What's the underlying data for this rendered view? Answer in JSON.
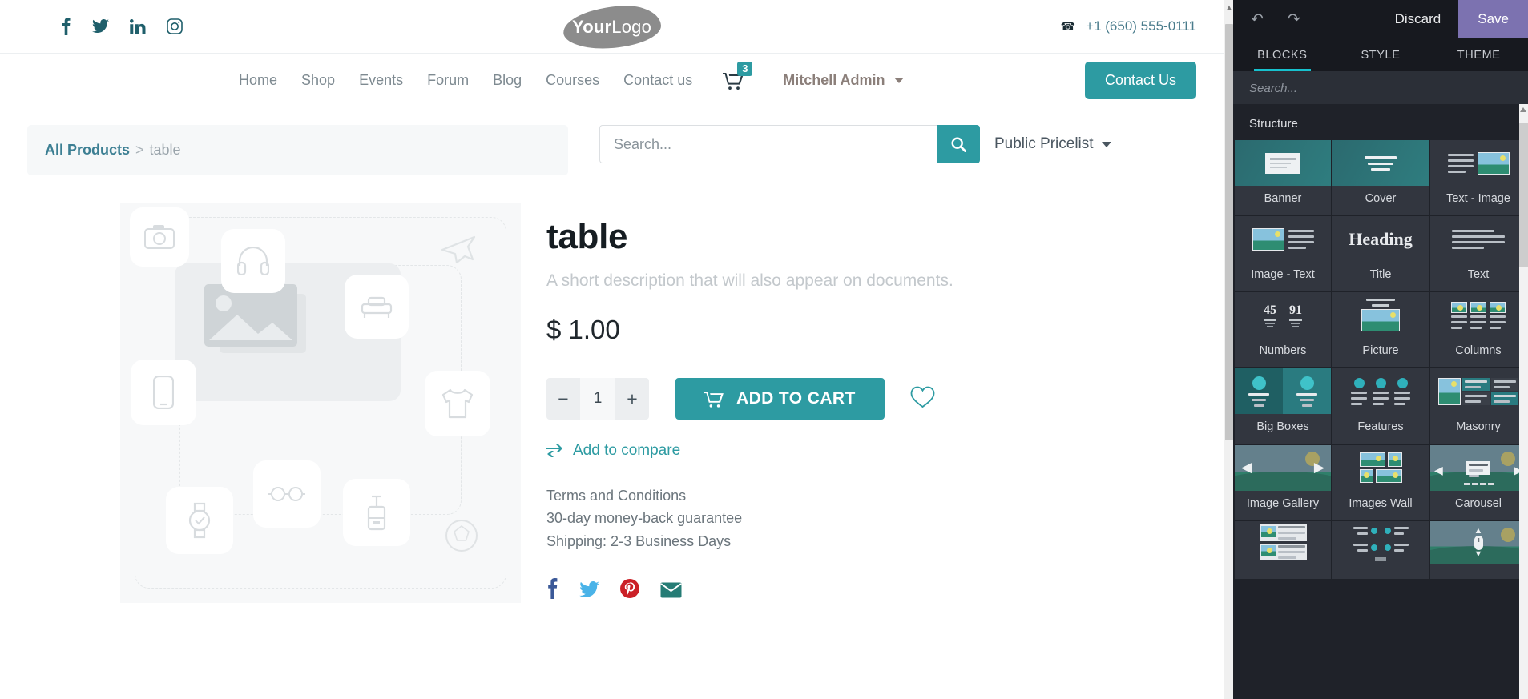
{
  "site": {
    "social_icons": [
      "facebook-icon",
      "twitter-icon",
      "linkedin-icon",
      "instagram-icon"
    ],
    "logo": {
      "bold": "Your",
      "light": "Logo"
    },
    "phone": "+1 (650) 555-0111",
    "nav": [
      {
        "label": "Home"
      },
      {
        "label": "Shop"
      },
      {
        "label": "Events"
      },
      {
        "label": "Forum"
      },
      {
        "label": "Blog"
      },
      {
        "label": "Courses"
      },
      {
        "label": "Contact us"
      }
    ],
    "cart_count": "3",
    "user_name": "Mitchell Admin",
    "contact_button": "Contact Us",
    "breadcrumb": {
      "root": "All Products",
      "separator": ">",
      "current": "table"
    },
    "search": {
      "placeholder": "Search...",
      "value": ""
    },
    "pricelist": "Public Pricelist",
    "product": {
      "title": "table",
      "description": "A short description that will also appear on documents.",
      "price": "$ 1.00",
      "quantity": "1",
      "add_to_cart": "ADD TO CART",
      "add_to_compare": "Add to compare",
      "terms": [
        "Terms and Conditions",
        "30-day money-back guarantee",
        "Shipping: 2-3 Business Days"
      ],
      "share_icons": [
        "facebook-share-icon",
        "twitter-share-icon",
        "pinterest-share-icon",
        "email-share-icon"
      ]
    }
  },
  "editor": {
    "undo_icon": "undo-icon",
    "redo_icon": "redo-icon",
    "discard_label": "Discard",
    "save_label": "Save",
    "save_color": "#7c72b0",
    "accent_color": "#17c1ce",
    "tabs": [
      {
        "label": "BLOCKS",
        "active": true
      },
      {
        "label": "STYLE",
        "active": false
      },
      {
        "label": "THEME",
        "active": false
      }
    ],
    "search_placeholder": "Search...",
    "section_title": "Structure",
    "blocks": [
      {
        "label": "Banner",
        "thumb": "banner"
      },
      {
        "label": "Cover",
        "thumb": "cover"
      },
      {
        "label": "Text - Image",
        "thumb": "text-image"
      },
      {
        "label": "Image - Text",
        "thumb": "image-text"
      },
      {
        "label": "Title",
        "thumb": "heading"
      },
      {
        "label": "Text",
        "thumb": "text"
      },
      {
        "label": "Numbers",
        "thumb": "numbers"
      },
      {
        "label": "Picture",
        "thumb": "picture"
      },
      {
        "label": "Columns",
        "thumb": "columns"
      },
      {
        "label": "Big Boxes",
        "thumb": "bigboxes"
      },
      {
        "label": "Features",
        "thumb": "features"
      },
      {
        "label": "Masonry",
        "thumb": "masonry"
      },
      {
        "label": "Image Gallery",
        "thumb": "gallery"
      },
      {
        "label": "Images Wall",
        "thumb": "imageswall"
      },
      {
        "label": "Carousel",
        "thumb": "carousel"
      },
      {
        "label": "",
        "thumb": "media-list"
      },
      {
        "label": "",
        "thumb": "comparisons"
      },
      {
        "label": "",
        "thumb": "mouse-scroll"
      }
    ],
    "numbers_thumb": {
      "a": "45",
      "b": "91"
    },
    "heading_thumb_text": "Heading"
  }
}
